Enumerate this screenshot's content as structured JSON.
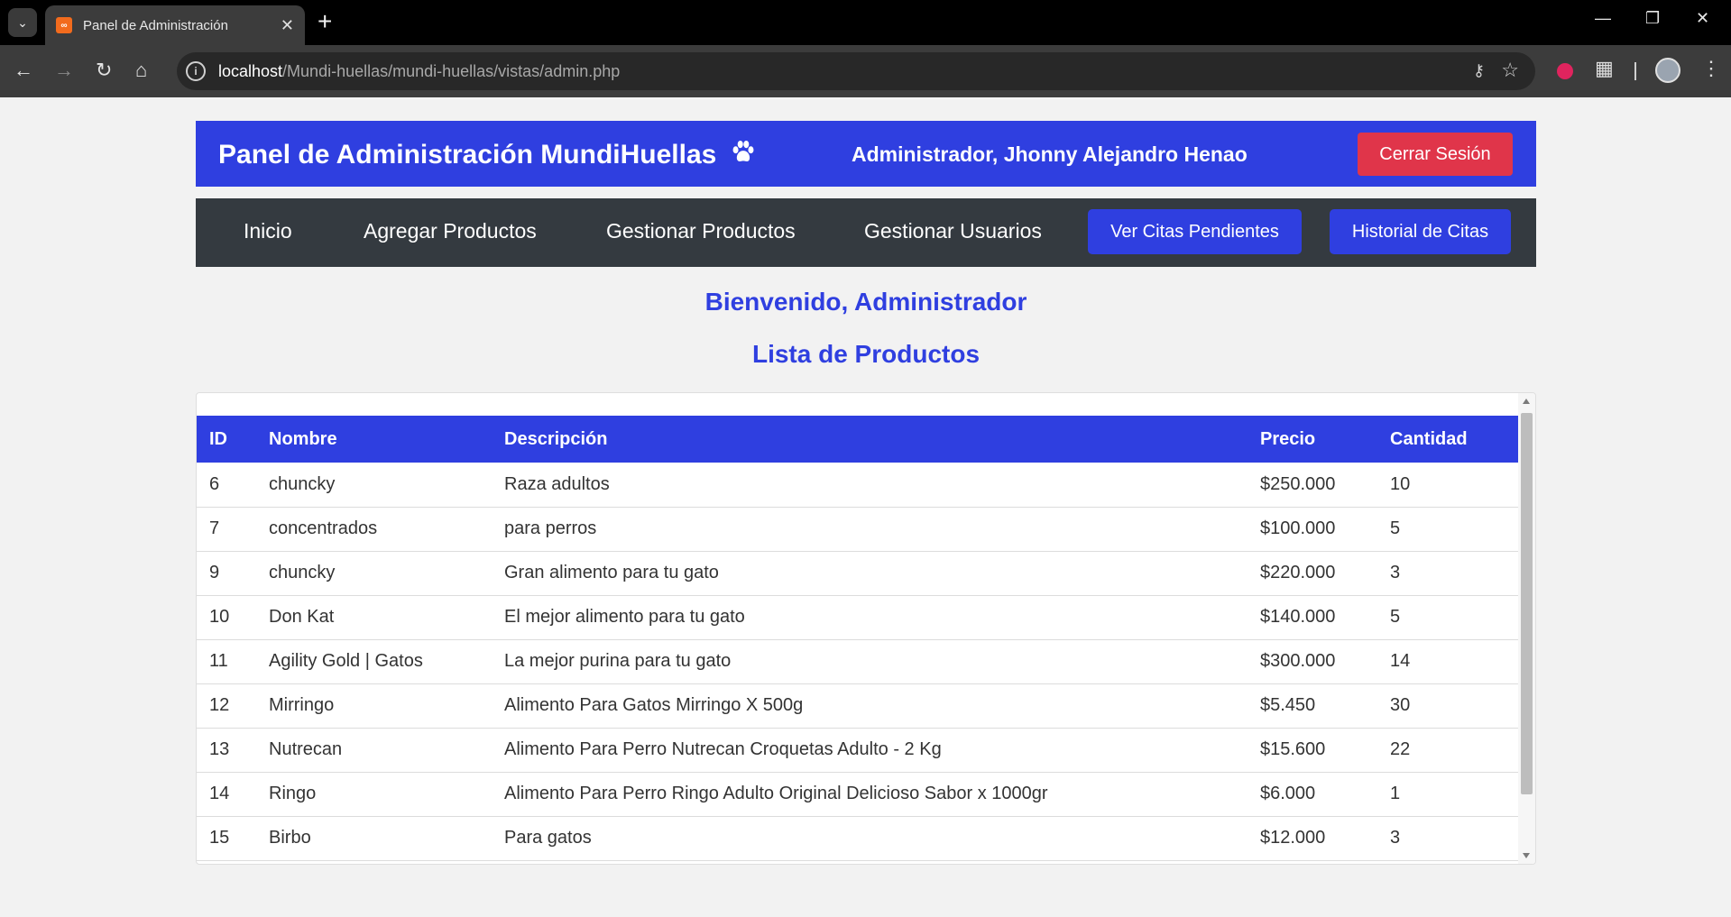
{
  "browser": {
    "tab_title": "Panel de Administración",
    "tab_favicon": "xampp-favicon-icon",
    "url_host": "localhost",
    "url_path": "/Mundi-huellas/mundi-huellas/vistas/admin.php"
  },
  "header": {
    "title": "Panel de Administración MundiHuellas",
    "title_icon": "paw-icon",
    "user_greeting": "Administrador, Jhonny Alejandro Henao",
    "logout_label": "Cerrar Sesión"
  },
  "nav": {
    "items": [
      {
        "label": "Inicio"
      },
      {
        "label": "Agregar Productos"
      },
      {
        "label": "Gestionar Productos"
      },
      {
        "label": "Gestionar Usuarios"
      }
    ],
    "buttons": [
      {
        "label": "Ver Citas Pendientes"
      },
      {
        "label": "Historial de Citas"
      }
    ]
  },
  "welcome": "Bienvenido, Administrador",
  "list_title": "Lista de Productos",
  "table": {
    "headers": {
      "id": "ID",
      "nombre": "Nombre",
      "descripcion": "Descripción",
      "precio": "Precio",
      "cantidad": "Cantidad"
    },
    "rows": [
      {
        "id": "6",
        "nombre": "chuncky",
        "descripcion": "Raza adultos",
        "precio": "$250.000",
        "cantidad": "10"
      },
      {
        "id": "7",
        "nombre": "concentrados",
        "descripcion": "para perros",
        "precio": "$100.000",
        "cantidad": "5"
      },
      {
        "id": "9",
        "nombre": "chuncky",
        "descripcion": "Gran alimento para tu gato",
        "precio": "$220.000",
        "cantidad": "3"
      },
      {
        "id": "10",
        "nombre": "Don Kat",
        "descripcion": "El mejor alimento para tu gato",
        "precio": "$140.000",
        "cantidad": "5"
      },
      {
        "id": "11",
        "nombre": "Agility Gold | Gatos",
        "descripcion": "La mejor purina para tu gato",
        "precio": "$300.000",
        "cantidad": "14"
      },
      {
        "id": "12",
        "nombre": "Mirringo",
        "descripcion": "Alimento Para Gatos Mirringo X 500g",
        "precio": "$5.450",
        "cantidad": "30"
      },
      {
        "id": "13",
        "nombre": "Nutrecan",
        "descripcion": "Alimento Para Perro Nutrecan Croquetas Adulto - 2 Kg",
        "precio": "$15.600",
        "cantidad": "22"
      },
      {
        "id": "14",
        "nombre": "Ringo",
        "descripcion": "Alimento Para Perro Ringo Adulto Original Delicioso Sabor x 1000gr",
        "precio": "$6.000",
        "cantidad": "1"
      },
      {
        "id": "15",
        "nombre": "Birbo",
        "descripcion": "Para gatos",
        "precio": "$12.000",
        "cantidad": "3"
      }
    ]
  },
  "colors": {
    "primary": "#2f3fe0",
    "navbar": "#343a40",
    "danger": "#e0354a",
    "background": "#f2f2f2"
  }
}
